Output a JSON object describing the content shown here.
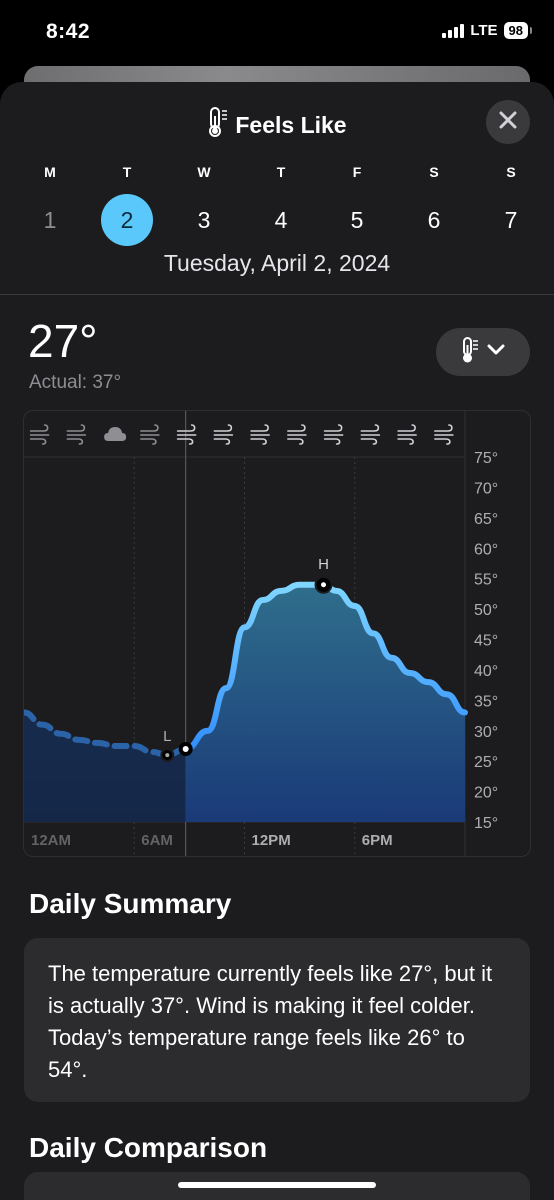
{
  "status": {
    "time": "8:42",
    "network": "LTE",
    "battery": "98"
  },
  "header": {
    "title": "Feels Like"
  },
  "week": [
    {
      "letter": "M",
      "num": "1"
    },
    {
      "letter": "T",
      "num": "2"
    },
    {
      "letter": "W",
      "num": "3"
    },
    {
      "letter": "T",
      "num": "4"
    },
    {
      "letter": "F",
      "num": "5"
    },
    {
      "letter": "S",
      "num": "6"
    },
    {
      "letter": "S",
      "num": "7"
    }
  ],
  "selected_day_index": 1,
  "date_label": "Tuesday, April 2, 2024",
  "current": {
    "feels_like": "27°",
    "actual": "Actual: 37°"
  },
  "chart_data": {
    "type": "area",
    "y_ticks": [
      "75°",
      "70°",
      "65°",
      "60°",
      "55°",
      "50°",
      "45°",
      "40°",
      "35°",
      "30°",
      "25°",
      "20°",
      "15°"
    ],
    "ylim": [
      15,
      75
    ],
    "x_ticks": [
      "12AM",
      "6AM",
      "12PM",
      "6PM"
    ],
    "x_hours": [
      0,
      6,
      12,
      18
    ],
    "condition_icons": [
      "wind-icon",
      "wind-icon",
      "cloud-icon",
      "wind-icon",
      "wind-icon",
      "wind-icon",
      "wind-icon",
      "wind-icon",
      "wind-icon",
      "wind-icon",
      "wind-icon",
      "wind-icon"
    ],
    "current_hour": 8.8,
    "low": {
      "label": "L",
      "hour": 7.8,
      "value": 26
    },
    "high": {
      "label": "H",
      "hour": 16.3,
      "value": 54
    },
    "series": [
      {
        "x": [
          0,
          1,
          2,
          3,
          4,
          5,
          6,
          7,
          7.8,
          8.8,
          10,
          11,
          12,
          13,
          14,
          15,
          16.3,
          17,
          18,
          19,
          20,
          21,
          22,
          23,
          24
        ],
        "y": [
          33,
          31,
          29.5,
          28.5,
          28,
          27.5,
          27.5,
          26.5,
          26,
          27,
          30,
          37,
          47,
          51.5,
          53,
          54,
          54,
          53,
          50.5,
          46,
          42,
          39.5,
          38,
          36,
          33
        ]
      }
    ]
  },
  "summary": {
    "title": "Daily Summary",
    "text": "The temperature currently feels like 27°, but it is actually 37°. Wind is making it feel colder. Today’s temperature range feels like 26° to 54°."
  },
  "comparison": {
    "title": "Daily Comparison"
  },
  "colors": {
    "accent": "#5ac8fa",
    "line": "#4ab4ff",
    "background": "#1c1c1e"
  }
}
